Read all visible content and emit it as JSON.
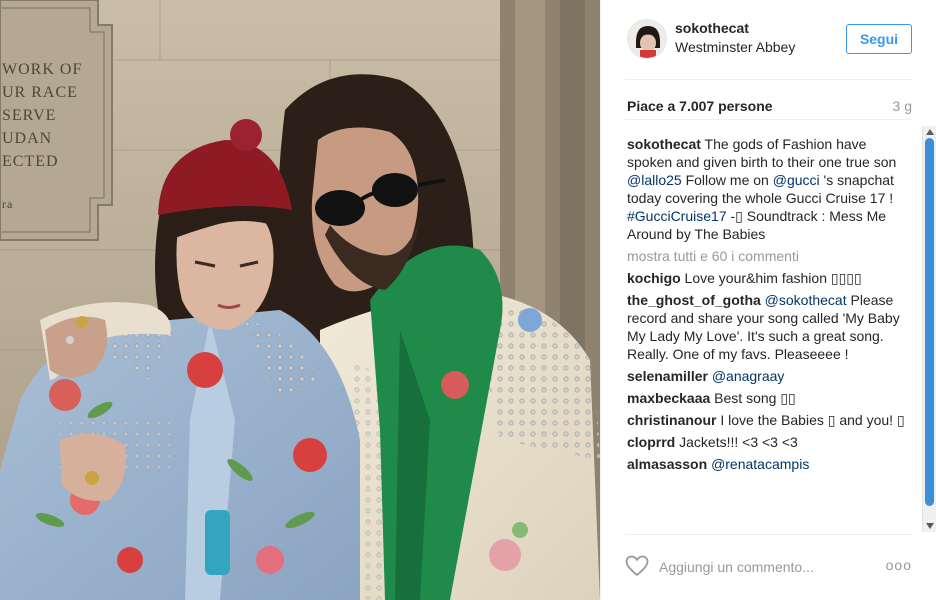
{
  "post": {
    "username": "sokothecat",
    "location": "Westminster Abbey",
    "follow_label": "Segui",
    "likes": "Piace a 7.007 persone",
    "age": "3 g"
  },
  "photo": {
    "plaque_lines": [
      "WORK OF",
      "UR RACE",
      "SERVE",
      "UDAN",
      "ECTED",
      "ra"
    ]
  },
  "caption": {
    "user": "sokothecat",
    "parts": [
      {
        "text": " The gods of Fashion have spoken and given birth to their one true son ",
        "mention": false
      },
      {
        "text": "@lallo25",
        "mention": true
      },
      {
        "text": " Follow me on ",
        "mention": false
      },
      {
        "text": "@gucci",
        "mention": true
      },
      {
        "text": " 's snapchat today covering the whole Gucci Cruise 17 ! ",
        "mention": false
      },
      {
        "text": "#GucciCruise17",
        "mention": true
      },
      {
        "text": " -▯ Soundtrack : Mess Me Around by The Babies",
        "mention": false
      }
    ]
  },
  "show_all": "mostra tutti e 60 i commenti",
  "comments": [
    {
      "user": "kochigo",
      "parts": [
        {
          "text": " Love your&him fashion ▯▯▯▯",
          "mention": false
        }
      ]
    },
    {
      "user": "the_ghost_of_gotha",
      "parts": [
        {
          "text": " ",
          "mention": false
        },
        {
          "text": "@sokothecat",
          "mention": true
        },
        {
          "text": " Please record and share your song called 'My Baby My Lady My Love'. It's such a great song. Really. One of my favs. Pleaseeee !",
          "mention": false
        }
      ]
    },
    {
      "user": "selenamiller",
      "parts": [
        {
          "text": " ",
          "mention": false
        },
        {
          "text": "@anagraay",
          "mention": true
        }
      ]
    },
    {
      "user": "maxbeckaaa",
      "parts": [
        {
          "text": " Best song ▯▯",
          "mention": false
        }
      ]
    },
    {
      "user": "christinanour",
      "parts": [
        {
          "text": " I love the Babies ▯ and you! ▯",
          "mention": false
        }
      ]
    },
    {
      "user": "cloprrd",
      "parts": [
        {
          "text": " Jackets!!! <3 <3 <3",
          "mention": false
        }
      ]
    },
    {
      "user": "almasasson",
      "parts": [
        {
          "text": " ",
          "mention": false
        },
        {
          "text": "@renatacampis",
          "mention": true
        }
      ]
    }
  ],
  "comment_box": {
    "placeholder": "Aggiungi un commento..."
  },
  "options_label": "ooo",
  "icons": {
    "like": "heart-icon",
    "options": "more-options-icon",
    "avatar": "avatar"
  },
  "colors": {
    "accent": "#3897f0",
    "mention": "#003569",
    "muted": "#999999"
  }
}
